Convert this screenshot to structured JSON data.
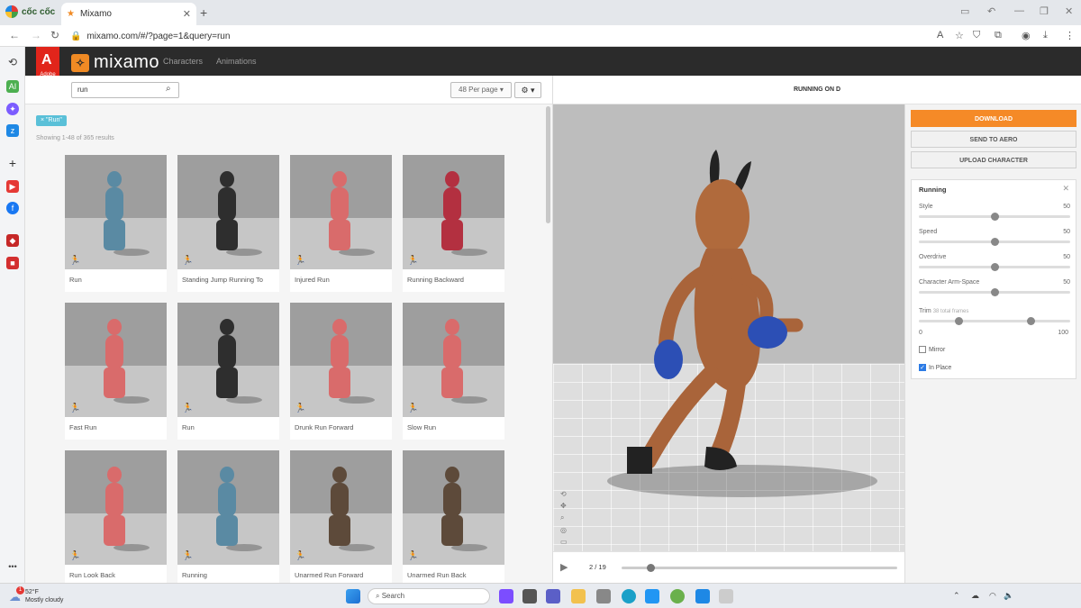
{
  "browser": {
    "brand": "cốc cốc",
    "tab_title": "Mixamo",
    "tab_close": "✕",
    "new_tab": "+",
    "url": "mixamo.com/#/?page=1&query=run"
  },
  "mixamo": {
    "logo_text": "mixamo",
    "adobe_label": "Adobe",
    "nav": [
      "Characters",
      "Animations"
    ],
    "search_value": "run",
    "per_page": "48 Per page",
    "filter_chip": "× \"Run\"",
    "result_count": "Showing 1-48 of 365 results",
    "cards": [
      {
        "title": "Run",
        "color": "#5a8aa3"
      },
      {
        "title": "Standing Jump Running To",
        "color": "#2e2e2e"
      },
      {
        "title": "Injured Run",
        "color": "#d96b6b"
      },
      {
        "title": "Running Backward",
        "color": "#b33040"
      },
      {
        "title": "Fast Run",
        "color": "#d96b6b"
      },
      {
        "title": "Run",
        "color": "#2e2e2e"
      },
      {
        "title": "Drunk Run Forward",
        "color": "#d96b6b"
      },
      {
        "title": "Slow Run",
        "color": "#d96b6b"
      },
      {
        "title": "Run Look Back",
        "color": "#d96b6b"
      },
      {
        "title": "Running",
        "color": "#5a8aa3"
      },
      {
        "title": "Unarmed Run Forward",
        "color": "#5d4a3a"
      },
      {
        "title": "Unarmed Run Back",
        "color": "#5d4a3a"
      }
    ]
  },
  "viewer": {
    "title": "RUNNING ON D",
    "frame": "2 / 19",
    "progress": 0.105
  },
  "panel": {
    "download": "DOWNLOAD",
    "send_aero": "SEND TO AERO",
    "upload": "UPLOAD CHARACTER",
    "settings_title": "Running",
    "sliders": [
      {
        "label": "Style",
        "value": "50",
        "pos": 0.5
      },
      {
        "label": "Speed",
        "value": "50",
        "pos": 0.5
      },
      {
        "label": "Overdrive",
        "value": "50",
        "pos": 0.5
      },
      {
        "label": "Character Arm-Space",
        "value": "50",
        "pos": 0.5
      }
    ],
    "trim_label": "Trim",
    "trim_note": "38 total frames",
    "trim_min": "0",
    "trim_max": "100",
    "mirror_label": "Mirror",
    "mirror_checked": false,
    "inplace_label": "In Place",
    "inplace_checked": true
  },
  "taskbar": {
    "weather_temp": "52°F",
    "weather_desc": "Mostly cloudy",
    "weather_badge": "1",
    "search_placeholder": "Search"
  }
}
